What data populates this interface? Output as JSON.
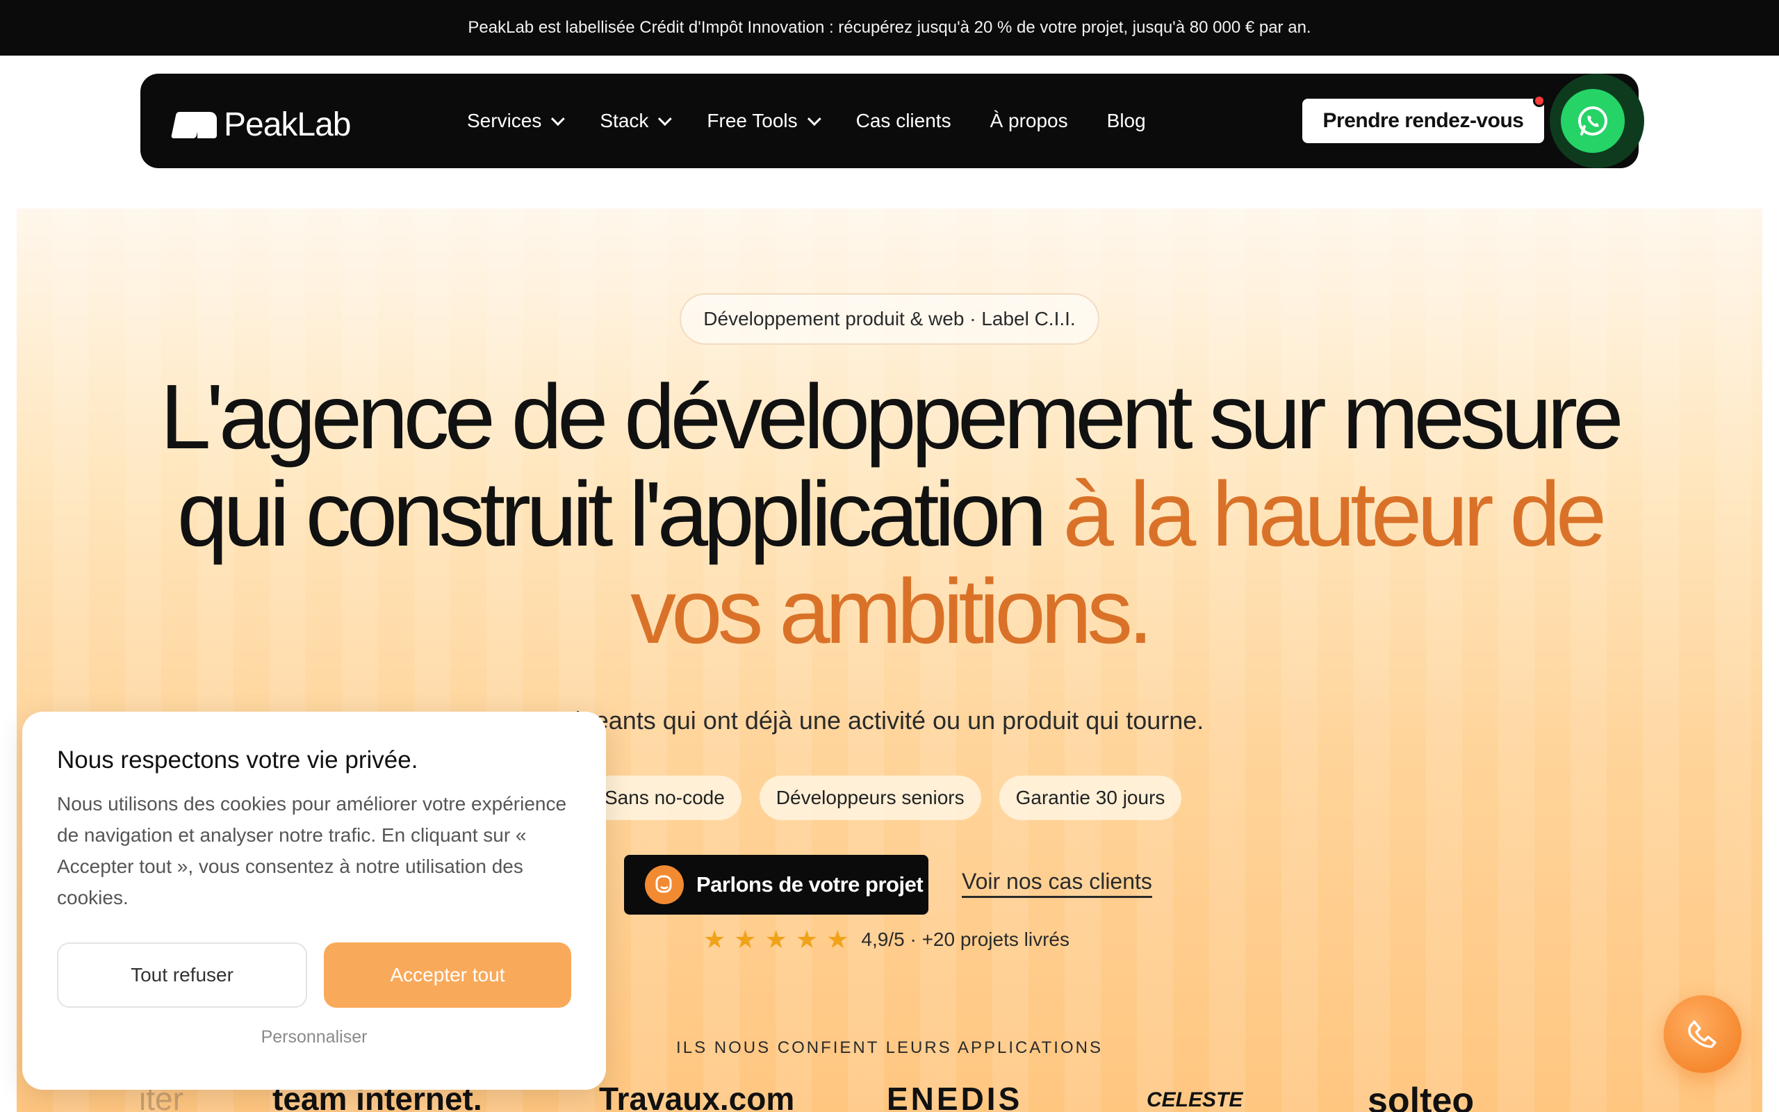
{
  "announcement": "PeakLab est labellisée Crédit d'Impôt Innovation : récupérez jusqu'à 20 % de votre projet, jusqu'à 80 000 € par an.",
  "nav": {
    "logo": "PeakLab",
    "items": [
      {
        "label": "Services",
        "has_dropdown": true
      },
      {
        "label": "Stack",
        "has_dropdown": true
      },
      {
        "label": "Free Tools",
        "has_dropdown": true
      },
      {
        "label": "Cas clients",
        "has_dropdown": false
      },
      {
        "label": "À propos",
        "has_dropdown": false
      },
      {
        "label": "Blog",
        "has_dropdown": false
      }
    ],
    "cta": "Prendre rendez-vous",
    "whatsapp_icon": "whatsapp-icon"
  },
  "hero": {
    "pill": "Développement produit & web · Label C.I.I.",
    "headline_line1": "L'agence de développement sur mesure",
    "headline_line2": "qui construit l'application ",
    "headline_accent1": "à la hauteur de",
    "headline_accent2": "vos ambitions.",
    "subtitle": "igeants qui ont déjà une activité ou un produit qui tourne.",
    "chips": [
      "Sans no-code",
      "Développeurs seniors",
      "Garantie 30 jours"
    ],
    "cta_primary": "Parlons de votre projet",
    "cta_secondary": "Voir nos cas clients",
    "rating": {
      "stars": 5,
      "text": "4,9/5 · +20 projets livrés"
    },
    "trust_label": "ILS NOUS CONFIENT LEURS APPLICATIONS",
    "client_logos": [
      "iter",
      "team internet.",
      "Travaux.com",
      "ENEDIS",
      "CELESTE",
      "solteo"
    ]
  },
  "cookie": {
    "title": "Nous respectons votre vie privée.",
    "body": "Nous utilisons des cookies pour améliorer votre expérience de navigation et analyser notre trafic. En cliquant sur « Accepter tout », vous consentez à notre utilisation des cookies.",
    "refuse": "Tout refuser",
    "accept": "Accepter tout",
    "customize": "Personnaliser"
  },
  "colors": {
    "accent": "#d97228",
    "cta_orange": "#f8a95a",
    "whatsapp": "#25d366",
    "dark": "#0b0b0b"
  }
}
